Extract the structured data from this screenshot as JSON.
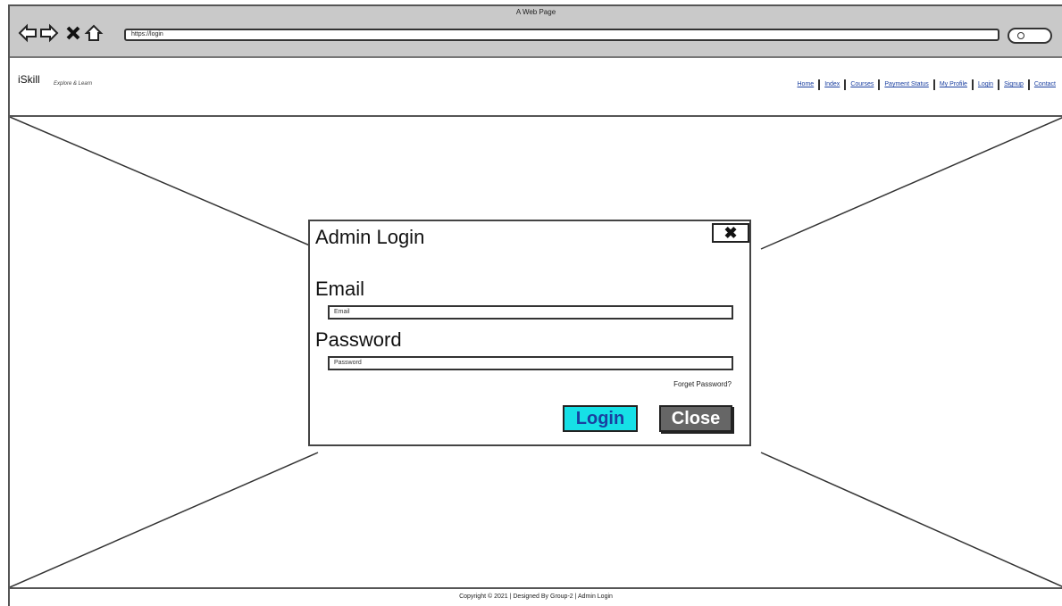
{
  "window": {
    "title": "A Web Page"
  },
  "toolbar": {
    "url": "https://login",
    "icons": [
      "back-arrow-icon",
      "forward-arrow-icon",
      "close-icon",
      "home-icon",
      "search-icon"
    ]
  },
  "header": {
    "brand": "iSkill",
    "tagline": "Explore & Learn",
    "nav": [
      "Home",
      "Index",
      "Courses",
      "Payment Status",
      "My Profile",
      "Login",
      "Signup",
      "Contact"
    ]
  },
  "modal": {
    "title": "Admin Login",
    "close_icon": "close-icon",
    "email_label": "Email",
    "email_placeholder": "Email",
    "password_label": "Password",
    "password_placeholder": "Password",
    "forgot_link": "Forget Password?",
    "login_button": "Login",
    "close_button": "Close"
  },
  "footer": {
    "text": "Copyright © 2021 | Designed By Group-2 | Admin Login"
  },
  "colors": {
    "login_button": "#16e0e6",
    "close_button": "#666666",
    "chrome": "#c9c9c9"
  }
}
